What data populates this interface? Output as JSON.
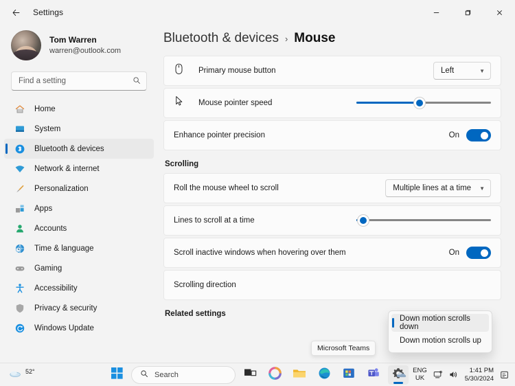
{
  "window": {
    "title": "Settings",
    "back_icon": "back-arrow-icon",
    "minimize_label": "–",
    "maximize_label": "❐",
    "close_label": "✕"
  },
  "sidebar": {
    "profile": {
      "name": "Tom Warren",
      "email": "warren@outlook.com"
    },
    "search": {
      "placeholder": "Find a setting",
      "icon": "search-icon"
    },
    "items": [
      {
        "label": "Home",
        "icon": "home-icon",
        "active": false
      },
      {
        "label": "System",
        "icon": "system-icon",
        "active": false
      },
      {
        "label": "Bluetooth & devices",
        "icon": "bluetooth-icon",
        "active": true
      },
      {
        "label": "Network & internet",
        "icon": "wifi-icon",
        "active": false
      },
      {
        "label": "Personalization",
        "icon": "brush-icon",
        "active": false
      },
      {
        "label": "Apps",
        "icon": "apps-icon",
        "active": false
      },
      {
        "label": "Accounts",
        "icon": "account-icon",
        "active": false
      },
      {
        "label": "Time & language",
        "icon": "clock-globe-icon",
        "active": false
      },
      {
        "label": "Gaming",
        "icon": "gamepad-icon",
        "active": false
      },
      {
        "label": "Accessibility",
        "icon": "accessibility-icon",
        "active": false
      },
      {
        "label": "Privacy & security",
        "icon": "shield-icon",
        "active": false
      },
      {
        "label": "Windows Update",
        "icon": "update-icon",
        "active": false
      }
    ]
  },
  "main": {
    "breadcrumb": {
      "parent": "Bluetooth & devices",
      "separator": "›",
      "current": "Mouse"
    },
    "primary_button": {
      "label": "Primary mouse button",
      "icon": "mouse-icon",
      "value": "Left"
    },
    "pointer_speed": {
      "label": "Mouse pointer speed",
      "icon": "cursor-icon",
      "value_percent": 47
    },
    "enhance_precision": {
      "label": "Enhance pointer precision",
      "state_label": "On"
    },
    "scrolling_section": {
      "heading": "Scrolling",
      "wheel": {
        "label": "Roll the mouse wheel to scroll",
        "value": "Multiple lines at a time"
      },
      "lines": {
        "label": "Lines to scroll at a time",
        "value_percent": 5
      },
      "inactive_windows": {
        "label": "Scroll inactive windows when hovering over them",
        "state_label": "On"
      },
      "direction": {
        "label": "Scrolling direction",
        "options": [
          {
            "label": "Down motion scrolls down",
            "selected": true
          },
          {
            "label": "Down motion scrolls up",
            "selected": false
          }
        ]
      }
    },
    "related_settings": "Related settings"
  },
  "tooltip": {
    "text": "Microsoft Teams"
  },
  "taskbar": {
    "weather": {
      "temperature": "52°",
      "icon": "cloud-icon"
    },
    "start": {
      "icon": "windows-start-icon"
    },
    "search": {
      "placeholder": "Search",
      "icon": "search-icon"
    },
    "apps": [
      {
        "name": "task-view",
        "icon": "task-view-icon",
        "active": false
      },
      {
        "name": "copilot",
        "icon": "copilot-icon",
        "active": false
      },
      {
        "name": "file-explorer",
        "icon": "folder-icon",
        "active": false
      },
      {
        "name": "microsoft-edge",
        "icon": "edge-icon",
        "active": false
      },
      {
        "name": "microsoft-store",
        "icon": "store-icon",
        "active": false
      },
      {
        "name": "microsoft-teams",
        "icon": "teams-icon",
        "active": false
      },
      {
        "name": "settings",
        "icon": "settings-gear-icon",
        "active": true
      }
    ],
    "tray": {
      "onedrive_icon": "onedrive-icon",
      "language_top": "ENG",
      "language_bottom": "UK",
      "network_icon": "network-icon",
      "volume_icon": "volume-icon",
      "time": "1:41 PM",
      "date": "5/30/2024",
      "notification_icon": "notification-bell-icon"
    }
  },
  "colors": {
    "accent": "#0067c0",
    "window_bg": "#f3f3f3",
    "card_bg": "#fbfbfb"
  }
}
